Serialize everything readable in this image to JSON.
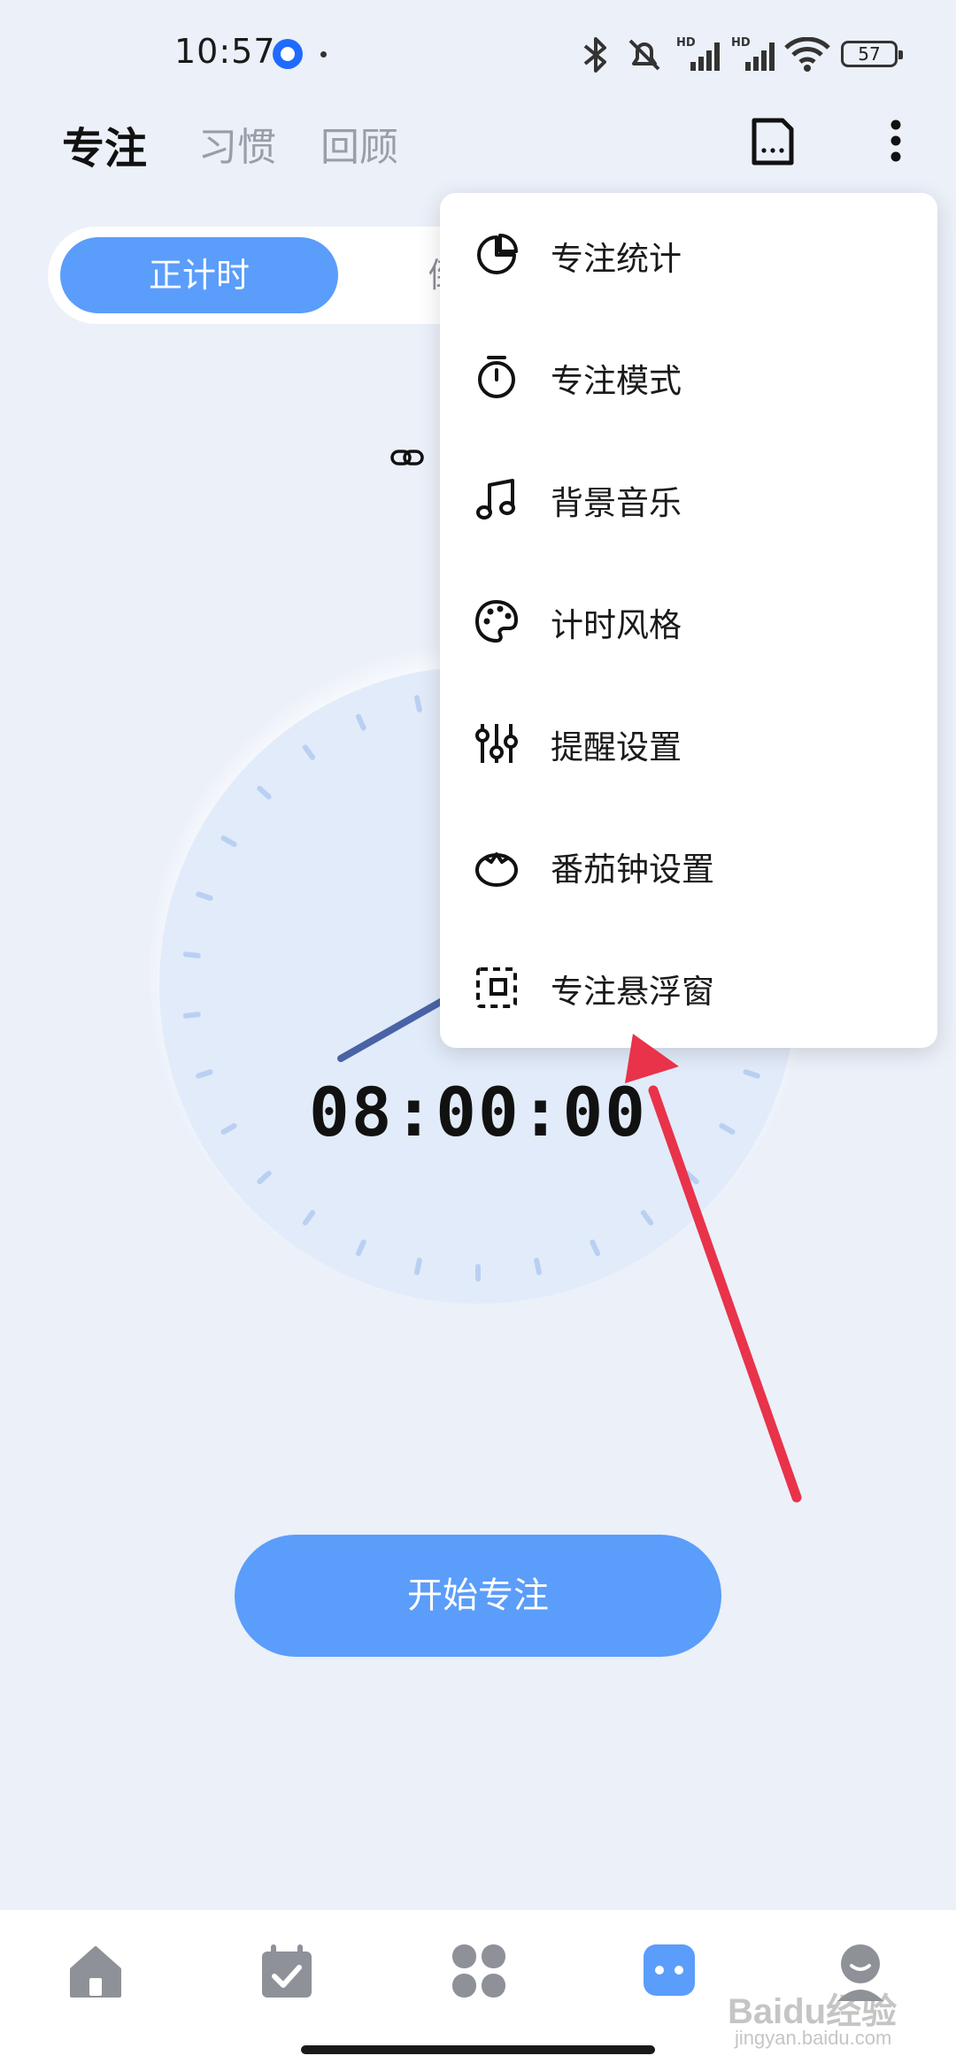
{
  "status_bar": {
    "time": "10:57",
    "battery": "57",
    "signal_label_1": "HD",
    "signal_label_2": "HD",
    "icons": [
      "app-icon",
      "bluetooth-icon",
      "mute-icon",
      "signal-icon",
      "signal-icon",
      "wifi-icon",
      "battery-icon"
    ]
  },
  "header": {
    "tabs": [
      {
        "label": "专注",
        "active": true
      },
      {
        "label": "习惯",
        "active": false
      },
      {
        "label": "回顾",
        "active": false
      }
    ],
    "icons": [
      "note-icon",
      "more-vert-icon"
    ]
  },
  "mode_switch": {
    "options": [
      {
        "label": "正计时",
        "selected": true
      },
      {
        "label": "倒",
        "selected": false
      }
    ]
  },
  "timer": {
    "readout": "08:00:00"
  },
  "start_button": {
    "label": "开始专注"
  },
  "menu": {
    "items": [
      {
        "label": "专注统计",
        "icon": "pie-chart-icon"
      },
      {
        "label": "专注模式",
        "icon": "stopwatch-icon"
      },
      {
        "label": "背景音乐",
        "icon": "music-note-icon"
      },
      {
        "label": "计时风格",
        "icon": "palette-icon"
      },
      {
        "label": "提醒设置",
        "icon": "sliders-icon"
      },
      {
        "label": "番茄钟设置",
        "icon": "tomato-icon"
      },
      {
        "label": "专注悬浮窗",
        "icon": "floating-window-icon"
      }
    ]
  },
  "bottom_nav": {
    "items": [
      {
        "icon": "home-icon"
      },
      {
        "icon": "calendar-check-icon"
      },
      {
        "icon": "apps-icon"
      },
      {
        "icon": "focus-icon",
        "active": true
      },
      {
        "icon": "profile-icon"
      }
    ]
  },
  "watermark": {
    "text": "Baidu经验",
    "sub": "jingyan.baidu.com"
  },
  "colors": {
    "accent": "#5b9dfa",
    "background": "#ebf0f9",
    "arrow": "#e8334a",
    "hand": "#4a63a6"
  }
}
